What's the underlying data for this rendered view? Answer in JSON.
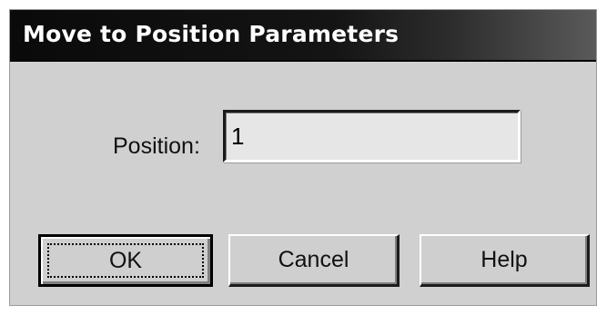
{
  "dialog": {
    "title": "Move to Position Parameters",
    "position_label": "Position:",
    "position_value": "1",
    "ok_label": "OK",
    "cancel_label": "Cancel",
    "help_label": "Help"
  }
}
